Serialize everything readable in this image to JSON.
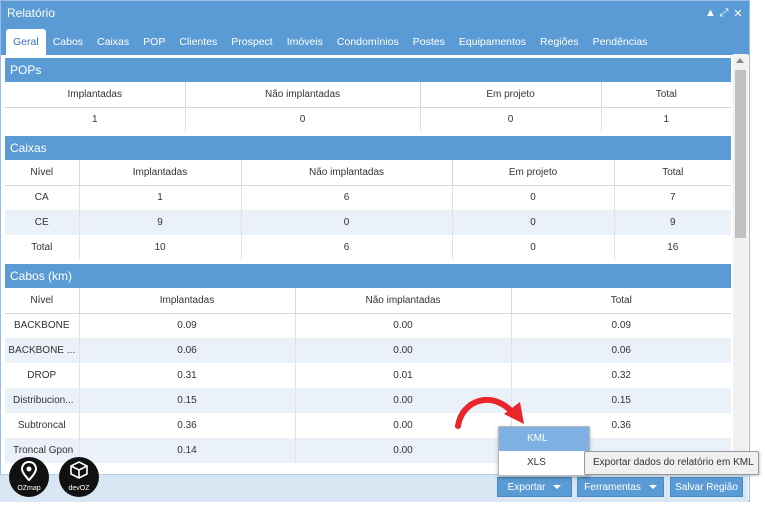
{
  "window": {
    "title": "Relatório",
    "controls": [
      "▲",
      "⤢",
      "✕"
    ]
  },
  "tabs": [
    "Geral",
    "Cabos",
    "Caixas",
    "POP",
    "Clientes",
    "Prospect",
    "Imóveis",
    "Condomínios",
    "Postes",
    "Equipamentos",
    "Regiões",
    "Pendências"
  ],
  "pops": {
    "title": "POPs",
    "headers": [
      "Implantadas",
      "Não implantadas",
      "Em projeto",
      "Total"
    ],
    "row": [
      "1",
      "0",
      "0",
      "1"
    ]
  },
  "caixas": {
    "title": "Caixas",
    "headers": [
      "Nível",
      "Implantadas",
      "Não implantadas",
      "Em projeto",
      "Total"
    ],
    "rows": [
      [
        "CA",
        "1",
        "6",
        "0",
        "7"
      ],
      [
        "CE",
        "9",
        "0",
        "0",
        "9"
      ],
      [
        "Total",
        "10",
        "6",
        "0",
        "16"
      ]
    ]
  },
  "cabos": {
    "title": "Cabos (km)",
    "headers": [
      "Nível",
      "Implantadas",
      "Não implantadas",
      "Total"
    ],
    "rows": [
      [
        "BACKBONE",
        "0.09",
        "0.00",
        "0.09"
      ],
      [
        "BACKBONE ...",
        "0.06",
        "0.00",
        "0.06"
      ],
      [
        "DROP",
        "0.31",
        "0.01",
        "0.32"
      ],
      [
        "Distribucion...",
        "0.15",
        "0.00",
        "0.15"
      ],
      [
        "Subtroncal",
        "0.36",
        "0.00",
        "0.36"
      ],
      [
        "Troncal Gpon",
        "0.14",
        "0.00",
        ""
      ]
    ]
  },
  "footer": {
    "exportar": "Exportar",
    "ferramentas": "Ferramentas",
    "salvar": "Salvar Região"
  },
  "dropdown": {
    "options": [
      "KML",
      "XLS"
    ]
  },
  "tooltip": "Exportar dados do relatório em KML",
  "logos": {
    "ozmap": "OZmap",
    "devoz": "devOZ"
  },
  "colors": {
    "header_blue": "#5b9bd5",
    "row_alt": "#eaf1f8",
    "arrow_red": "#e8262c"
  }
}
